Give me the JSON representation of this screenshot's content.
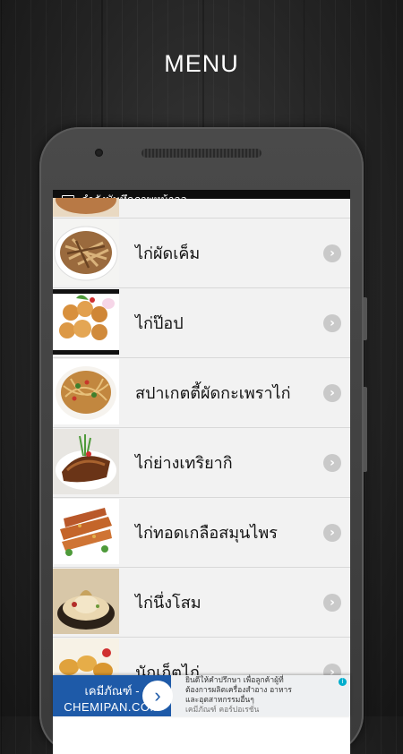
{
  "header": {
    "title": "MENU"
  },
  "status_bar": {
    "notification": "กำลังบันทึกภาพหน้าจอ...",
    "icon": "gallery-icon"
  },
  "menu_items": [
    {
      "label": "ไก่ผัดเค็ม",
      "image": "food-thumbnail"
    },
    {
      "label": "ไก่ป๊อป",
      "image": "food-thumbnail"
    },
    {
      "label": "สปาเกตตี้ผัดกะเพราไก่",
      "image": "food-thumbnail"
    },
    {
      "label": "ไก่ย่างเทริยากิ",
      "image": "food-thumbnail"
    },
    {
      "label": "ไก่ทอดเกลือสมุนไพร",
      "image": "food-thumbnail"
    },
    {
      "label": "ไก่นึ่งโสม",
      "image": "food-thumbnail"
    },
    {
      "label": "นักเก็ตไก่",
      "image": "food-thumbnail"
    }
  ],
  "chevron": {
    "icon": "chevron-right-icon",
    "glyph": "›"
  },
  "ad": {
    "name": "เคมีภัณฑ์ -",
    "domain": "CHEMIPAN.COM",
    "go_glyph": "›",
    "line1": "ยินดีให้คำปรึกษา เพื่อลูกค้าผู้ที่",
    "line2": "ต้องการผลิตเครื่องสำอาง อาหาร",
    "line3": "และอุตสาหกรรมอื่นๆ",
    "line4": "เคมีภัณฑ์ คอร์ปอเรชั่น",
    "info_glyph": "i",
    "brand_color": "#1e5aa8"
  }
}
